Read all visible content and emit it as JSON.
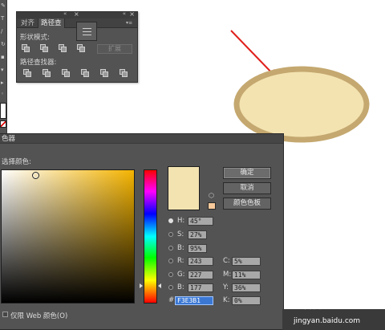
{
  "pathfinder_panel": {
    "tabs": [
      "对齐",
      "路径查"
    ],
    "shape_modes_label": "形状模式:",
    "expand_label": "扩展",
    "pathfinders_label": "路径查找器:"
  },
  "color_picker": {
    "title": "色器",
    "select_color_label": "选择颜色:",
    "ok_label": "确定",
    "cancel_label": "取消",
    "swatches_label": "颜色色板",
    "fields": {
      "H": {
        "label": "H:",
        "value": "45°"
      },
      "S": {
        "label": "S:",
        "value": "27%"
      },
      "B": {
        "label": "B:",
        "value": "95%"
      },
      "R": {
        "label": "R:",
        "value": "243"
      },
      "G": {
        "label": "G:",
        "value": "227"
      },
      "Bl": {
        "label": "B:",
        "value": "177"
      },
      "C": {
        "label": "C:",
        "value": "5%"
      },
      "M": {
        "label": "M:",
        "value": "11%"
      },
      "Y": {
        "label": "Y:",
        "value": "36%"
      },
      "K": {
        "label": "K:",
        "value": "0%"
      },
      "hex_prefix": "#",
      "hex": "F3E3B1"
    },
    "web_only_label": "仅限 Web 颜色(O)",
    "new_color": "#f3e3b1",
    "websafe_color": "#f7c99a"
  },
  "canvas": {
    "ellipse_fill": "#f3e3b1",
    "ellipse_stroke": "#c4a86f",
    "arrow_color": "#e0201c"
  },
  "watermark": {
    "brand": "Bai百度",
    "url": "jingyan.baidu.com"
  }
}
